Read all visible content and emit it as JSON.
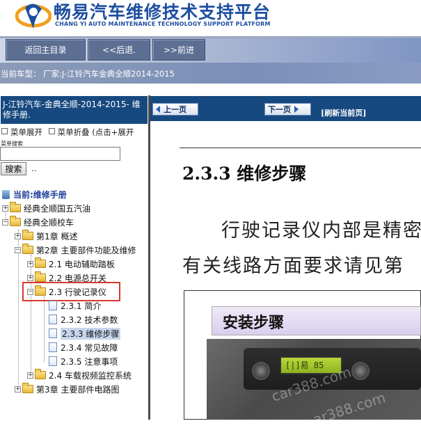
{
  "header": {
    "title": "畅易汽车维修技术支持平台",
    "subtitle": "CHANG YI AUTO MAINTENANCE TECHNOLOGY SUPPORT PLATFORM"
  },
  "nav": {
    "home": "返回主目录",
    "back": "<<后退.",
    "forward": ">>前进"
  },
  "breadcrumb": "当前车型： 厂家:J-江铃汽车金典全顺2014-2015",
  "left": {
    "heading": "J-江铃汽车-金典全顺-2014-2015- 维修手册.",
    "expand": "菜单展开",
    "collapse": "菜单折叠 (点击+展开",
    "search_label": "菜单搜索",
    "search_value": "",
    "search_button": "搜索",
    "dots": "..",
    "tree": {
      "root": "当前:维修手册",
      "n1": "经典全顺国五汽油",
      "n2": "经典全顺校车",
      "n3": "第1章 概述",
      "n4": "第2章 主要部件功能及维修",
      "n5": "2.1 电动辅助踏板",
      "n6": "2.2 电源总开关",
      "n7": "2.3 行驶记录仪",
      "n8": "2.3.1 简介",
      "n9": "2.3.2 技术参数",
      "n10": "2.3.3 维修步骤",
      "n11": "2.3.4 常见故障",
      "n12": "2.3.5 注意事项",
      "n13": "2.4 车载视频监控系统",
      "n14": "第3章 主要部件电路图"
    }
  },
  "right": {
    "prev": "上一页",
    "next": "下一页",
    "refresh": "[刷新当前页]",
    "section_title": "2.3.3  维修步骤",
    "para1": "行驶记录仪内部是精密",
    "para2": "有关线路方面要求请见第",
    "figure_label": "安装步骤",
    "watermark1": "car388.com",
    "watermark2": "ar388.com",
    "lcd_text": "[|]易 85"
  }
}
